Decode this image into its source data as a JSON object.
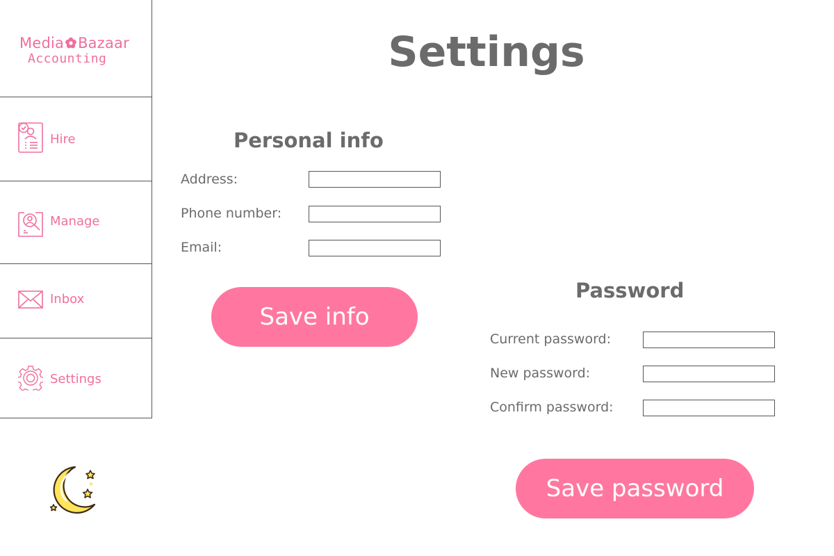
{
  "app": {
    "logo_line1_a": "Media",
    "logo_line1_b": "Bazaar",
    "logo_line2": "Accounting",
    "brand_color": "#ef6f9e"
  },
  "sidebar": {
    "items": [
      {
        "label": "Hire",
        "icon": "hire-document-icon"
      },
      {
        "label": "Manage",
        "icon": "manage-search-person-icon"
      },
      {
        "label": "Inbox",
        "icon": "envelope-icon"
      },
      {
        "label": "Settings",
        "icon": "gear-icon"
      }
    ],
    "theme_icon": "moon-stars-icon"
  },
  "main": {
    "title": "Settings",
    "personal": {
      "title": "Personal info",
      "fields": [
        {
          "label": "Address:",
          "value": ""
        },
        {
          "label": "Phone number:",
          "value": ""
        },
        {
          "label": "Email:",
          "value": ""
        }
      ],
      "save_label": "Save info"
    },
    "password": {
      "title": "Password",
      "fields": [
        {
          "label": "Current password:",
          "value": ""
        },
        {
          "label": "New password:",
          "value": ""
        },
        {
          "label": "Confirm password:",
          "value": ""
        }
      ],
      "save_label": "Save password"
    }
  },
  "colors": {
    "accent": "#ff77a1",
    "text": "#6b6b6b",
    "border": "#555555"
  }
}
